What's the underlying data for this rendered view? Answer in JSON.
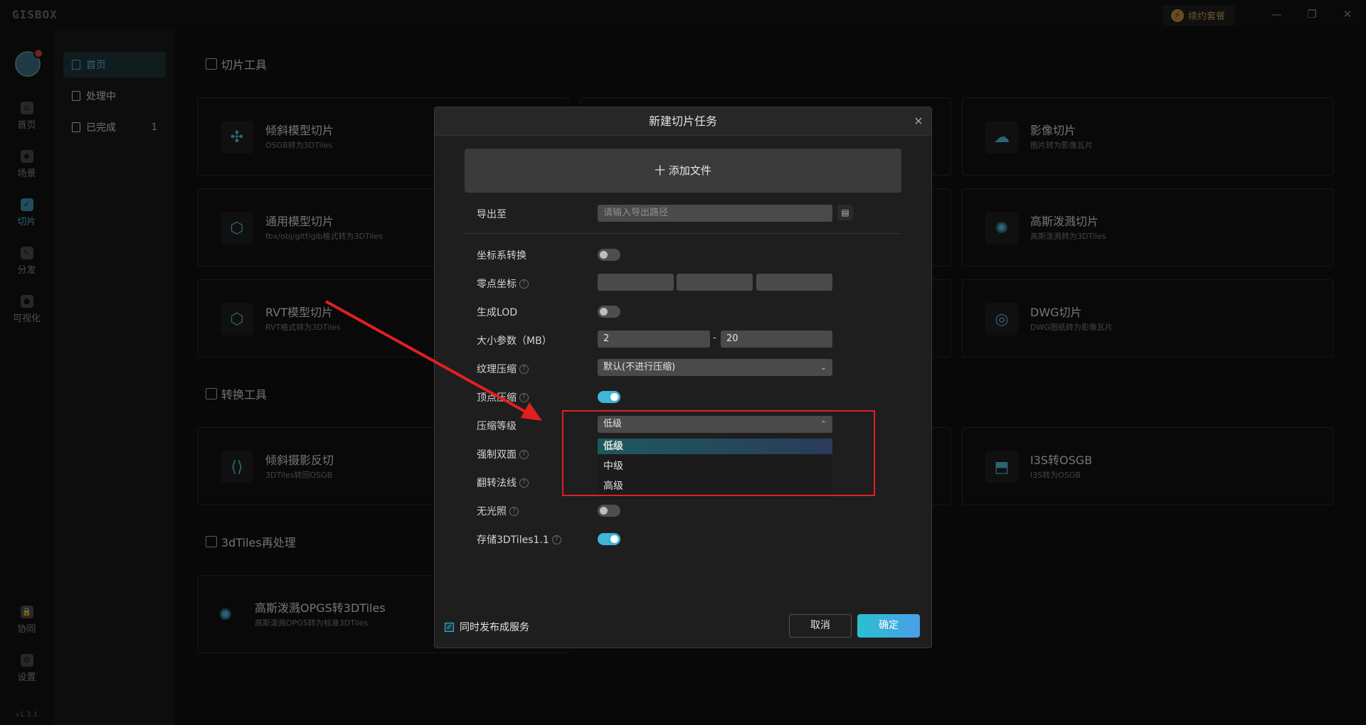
{
  "app": {
    "logo": "GISBOX",
    "renew_label": "续约套餐",
    "version": "v1.3.1"
  },
  "window": {
    "min": "—",
    "max": "❐",
    "close": "✕"
  },
  "nav": {
    "items": [
      {
        "label": "首页"
      },
      {
        "label": "场景"
      },
      {
        "label": "切片"
      },
      {
        "label": "分发"
      },
      {
        "label": "可视化"
      }
    ],
    "bottom": [
      {
        "label": "协同"
      },
      {
        "label": "设置"
      }
    ]
  },
  "subnav": {
    "items": [
      {
        "label": "首页",
        "count": ""
      },
      {
        "label": "处理中",
        "count": ""
      },
      {
        "label": "已完成",
        "count": "1"
      }
    ]
  },
  "sections": {
    "tiling": "切片工具",
    "convert": "转换工具",
    "reprocess": "3dTiles再处理"
  },
  "cards": {
    "oblique": {
      "title": "倾斜模型切片",
      "sub": "OSGB转为3DTiles"
    },
    "general": {
      "title": "通用模型切片",
      "sub": "fbx/obj/gltf/glb格式转为3DTiles"
    },
    "rvt": {
      "title": "RVT模型切片",
      "sub": "RVT格式转为3DTiles"
    },
    "image": {
      "title": "影像切片",
      "sub": "图片转为影像瓦片"
    },
    "gauss": {
      "title": "高斯泼溅切片",
      "sub": "高斯泼溅转为3DTiles"
    },
    "dwg": {
      "title": "DWG切片",
      "sub": "DWG图纸转为影像瓦片"
    },
    "reverse": {
      "title": "倾斜摄影反切",
      "sub": "3DTiles转回OSGB"
    },
    "i3s": {
      "title": "I3S转OSGB",
      "sub": "I3S转为OSGB"
    },
    "opgs": {
      "title": "高斯泼溅OPGS转3DTiles",
      "sub": "高斯泼溅OPGS转为标准3DTiles"
    }
  },
  "dialog": {
    "title": "新建切片任务",
    "add_file": "十 添加文件",
    "export_label": "导出至",
    "export_placeholder": "请输入导出路径",
    "coord_label": "坐标系转换",
    "origin_label": "零点坐标",
    "lod_label": "生成LOD",
    "size_label": "大小参数（MB）",
    "size_min": "2",
    "size_sep": "-",
    "size_max": "20",
    "texture_label": "纹理压缩",
    "texture_value": "默认(不进行压缩)",
    "vertex_label": "顶点压缩",
    "level_label": "压缩等级",
    "level_value": "低级",
    "level_options": [
      "低级",
      "中级",
      "高级"
    ],
    "doubleside_label": "强制双面",
    "flip_label": "翻转法线",
    "unlit_label": "无光照",
    "store_label": "存储3DTiles1.1",
    "publish_label": "同时发布成服务",
    "cancel": "取消",
    "ok": "确定"
  },
  "toggles": {
    "coord": false,
    "lod": false,
    "vertex": true,
    "unlit": false,
    "store": true
  },
  "colors": {
    "accent": "#3fb6d6",
    "highlight_box": "#e02020",
    "arrow": "#e02020"
  }
}
